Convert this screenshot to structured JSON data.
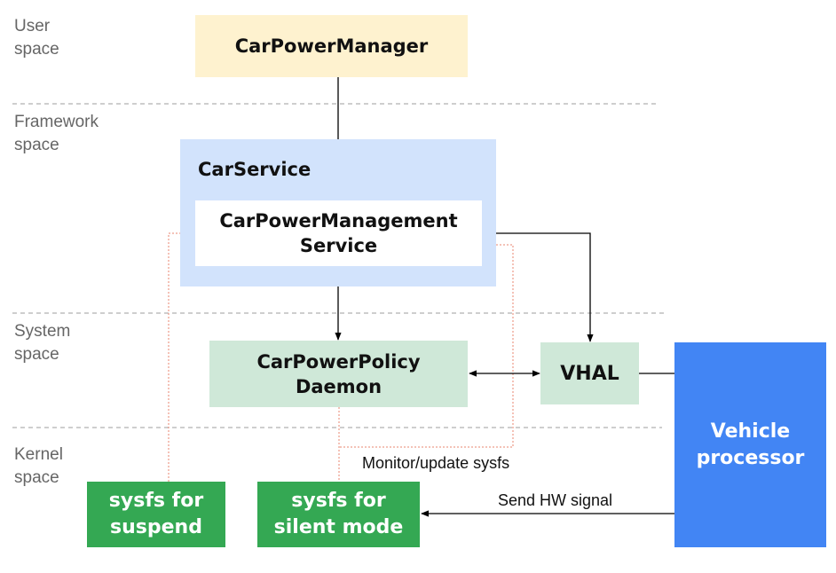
{
  "diagram": {
    "layers": [
      {
        "id": "user",
        "label": "User\nspace"
      },
      {
        "id": "framework",
        "label": "Framework\nspace"
      },
      {
        "id": "system",
        "label": "System\nspace"
      },
      {
        "id": "kernel",
        "label": "Kernel\nspace"
      }
    ],
    "nodes": {
      "car_power_manager": {
        "label": "CarPowerManager",
        "color": "#fef2cf"
      },
      "car_service": {
        "label": "CarService",
        "color": "#d2e3fc"
      },
      "car_power_management_service": {
        "label": "CarPowerManagement\nService",
        "color": "#ffffff"
      },
      "car_power_policy_daemon": {
        "label": "CarPowerPolicy\nDaemon",
        "color": "#cfe8d8"
      },
      "vhal": {
        "label": "VHAL",
        "color": "#cfe8d8"
      },
      "vehicle_processor": {
        "label": "Vehicle\nprocessor",
        "color": "#4285f4"
      },
      "sysfs_suspend": {
        "label": "sysfs for\nsuspend",
        "color": "#34a853"
      },
      "sysfs_silent_mode": {
        "label": "sysfs for\nsilent mode",
        "color": "#34a853"
      }
    },
    "edge_labels": {
      "monitor_update": "Monitor/update sysfs",
      "send_hw_signal": "Send HW signal"
    },
    "colors": {
      "divider": "#9e9e9e",
      "arrow": "#000000",
      "dotted_path": "#e8846f"
    }
  }
}
